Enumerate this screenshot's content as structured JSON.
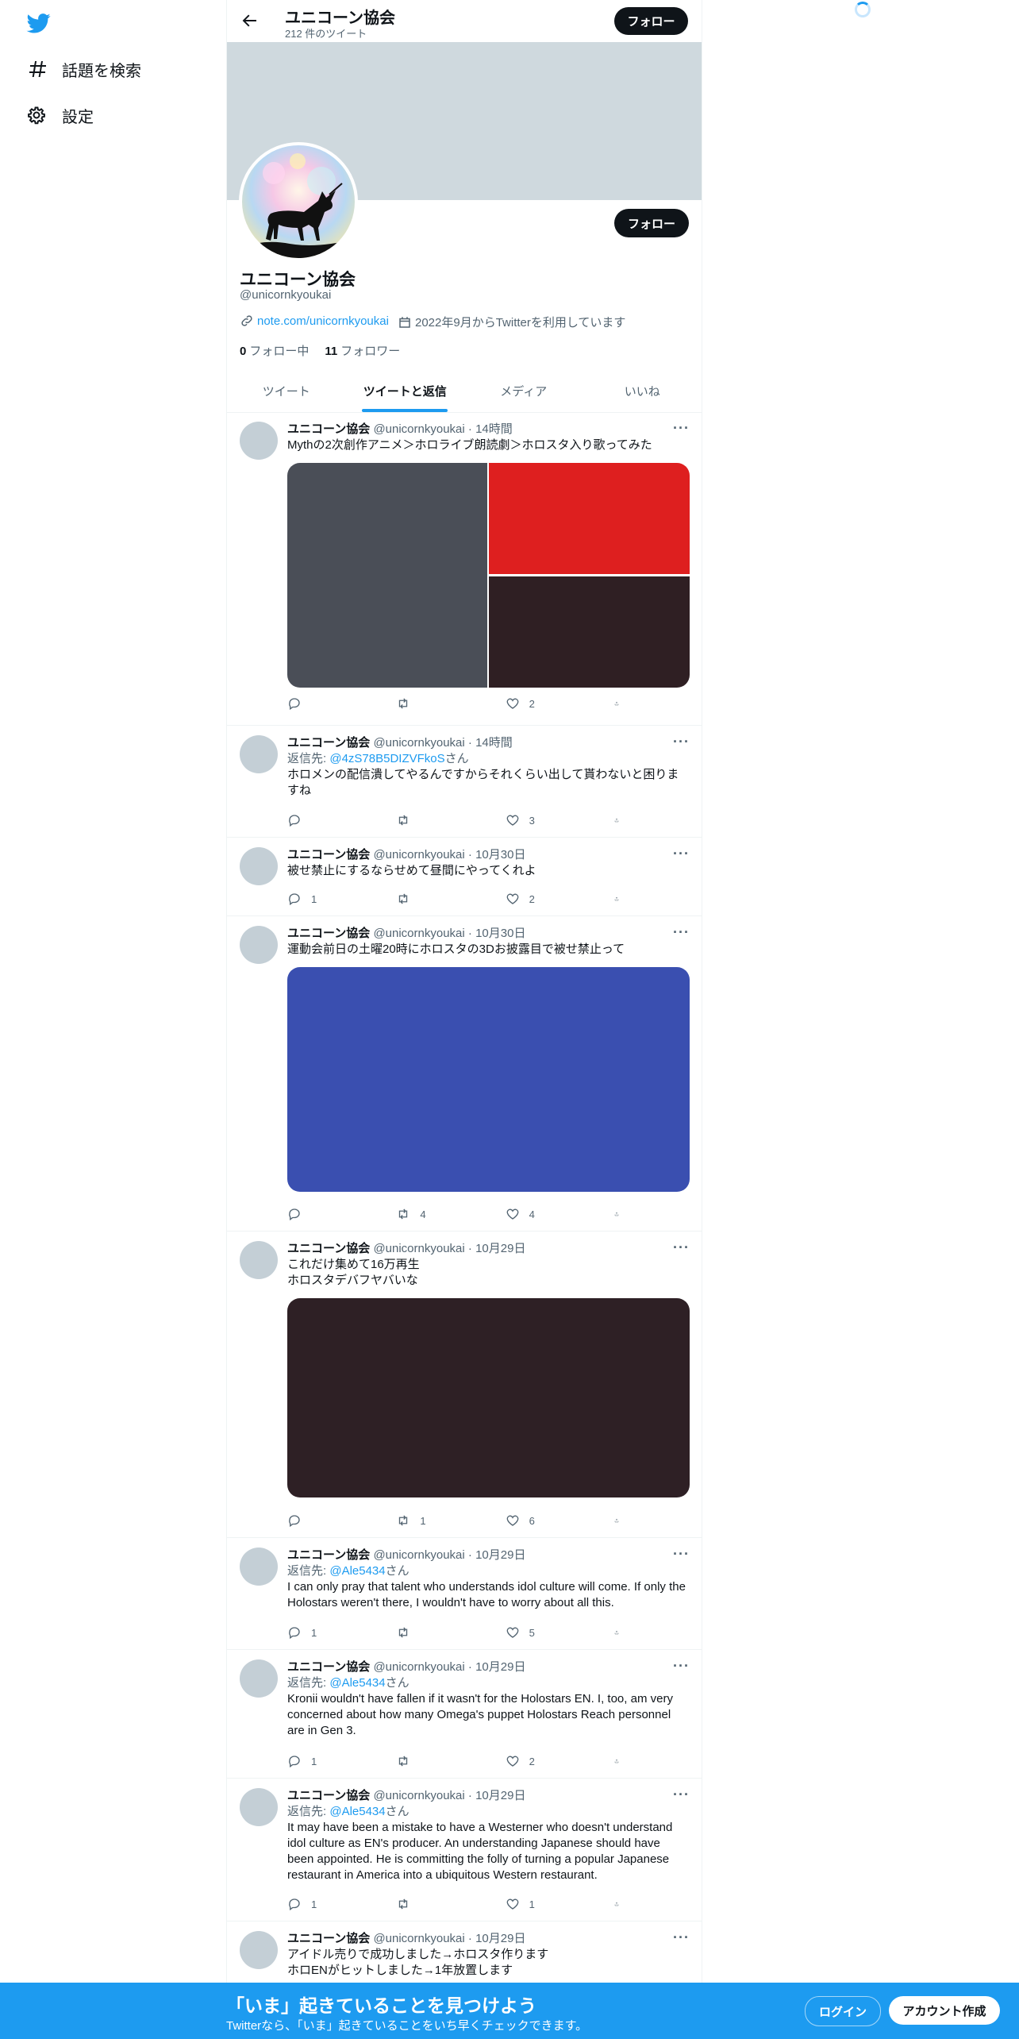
{
  "nav": {
    "explore": "話題を検索",
    "settings": "設定"
  },
  "header": {
    "title": "ユニコーン協会",
    "tweet_count": "212 件のツイート",
    "follow": "フォロー"
  },
  "profile": {
    "name": "ユニコーン協会",
    "handle": "@unicornkyoukai",
    "follow": "フォロー",
    "url": "note.com/unicornkyoukai",
    "joined": "2022年9月からTwitterを利用しています",
    "following_count": "0",
    "following_label": "フォロー中",
    "followers_count": "11",
    "followers_label": "フォロワー"
  },
  "tabs": [
    "ツイート",
    "ツイートと返信",
    "メディア",
    "いいね"
  ],
  "reply_prefix": "返信先: ",
  "reply_suffix": "さん",
  "tweets": [
    {
      "name": "ユニコーン協会",
      "handle": "@unicornkyoukai",
      "time": "14時間",
      "text": "Mythの2次創作アニメ＞ホロライブ朗読劇＞ホロスタ入り歌ってみた",
      "replies": "",
      "retweets": "",
      "likes": "2"
    },
    {
      "name": "ユニコーン協会",
      "handle": "@unicornkyoukai",
      "time": "14時間",
      "reply_to": "@4zS78B5DIZVFkoS",
      "text": "ホロメンの配信潰してやるんですからそれくらい出して貰わないと困りますね",
      "replies": "",
      "retweets": "",
      "likes": "3"
    },
    {
      "name": "ユニコーン協会",
      "handle": "@unicornkyoukai",
      "time": "10月30日",
      "text": "被せ禁止にするならせめて昼間にやってくれよ",
      "replies": "1",
      "retweets": "",
      "likes": "2"
    },
    {
      "name": "ユニコーン協会",
      "handle": "@unicornkyoukai",
      "time": "10月30日",
      "text": "運動会前日の土曜20時にホロスタの3Dお披露目で被せ禁止って",
      "replies": "",
      "retweets": "4",
      "likes": "4"
    },
    {
      "name": "ユニコーン協会",
      "handle": "@unicornkyoukai",
      "time": "10月29日",
      "text": "これだけ集めて16万再生\nホロスタデバフヤバいな",
      "replies": "",
      "retweets": "1",
      "likes": "6"
    },
    {
      "name": "ユニコーン協会",
      "handle": "@unicornkyoukai",
      "time": "10月29日",
      "reply_to": "@Ale5434",
      "text": "I can only pray that talent who understands idol culture will come. If only the Holostars weren't there, I wouldn't have to worry about all this.",
      "replies": "1",
      "retweets": "",
      "likes": "5"
    },
    {
      "name": "ユニコーン協会",
      "handle": "@unicornkyoukai",
      "time": "10月29日",
      "reply_to": "@Ale5434",
      "text": "Kronii wouldn't have fallen if it wasn't for the Holostars EN. I, too, am very concerned about how many Omega's puppet Holostars Reach personnel are in Gen 3.",
      "replies": "1",
      "retweets": "",
      "likes": "2"
    },
    {
      "name": "ユニコーン協会",
      "handle": "@unicornkyoukai",
      "time": "10月29日",
      "reply_to": "@Ale5434",
      "text": "It may have been a mistake to have a Westerner who doesn't understand idol culture as EN's producer. An understanding Japanese should have been appointed. He is committing the folly of turning a popular Japanese restaurant in America into a ubiquitous Western restaurant.",
      "replies": "1",
      "retweets": "",
      "likes": "1"
    },
    {
      "name": "ユニコーン協会",
      "handle": "@unicornkyoukai",
      "time": "10月29日",
      "text": "アイドル売りで成功しました→ホロスタ作ります\nホロENがヒットしました→1年放置します",
      "replies": "",
      "retweets": "",
      "likes": ""
    }
  ],
  "media_colors": {
    "grid_left": "#4a4e57",
    "grid_top_right": "#de1f1f",
    "grid_bottom_right": "#2f1f23",
    "single_blue": "#3a4fb0",
    "single_dark": "#2e2025"
  },
  "bottom": {
    "title": "「いま」起きていることを見つけよう",
    "subtitle": "Twitterなら、「いま」起きていることをいち早くチェックできます。",
    "login": "ログイン",
    "signup": "アカウント作成"
  },
  "colors": {
    "accent": "#1d9bf0",
    "banner": "#cfd9de"
  }
}
